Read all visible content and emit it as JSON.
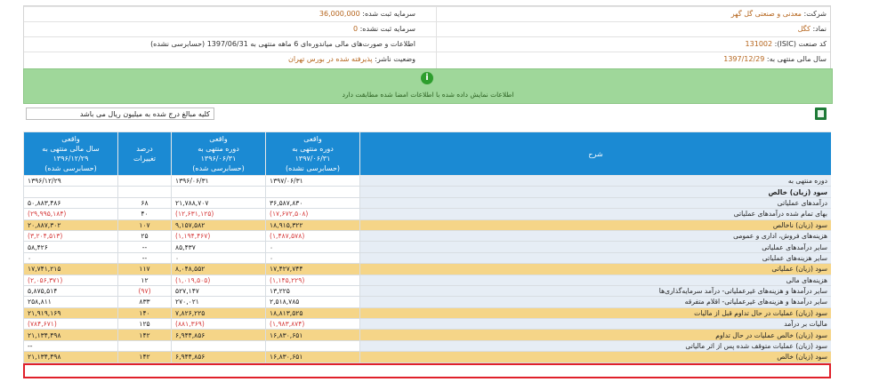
{
  "company_info": {
    "rows": [
      {
        "right_key": "شرکت:",
        "right_val": "معدنی و صنعتی گل گهر",
        "left_key": "سرمایه ثبت شده:",
        "left_val": "36,000,000"
      },
      {
        "right_key": "نماد:",
        "right_val": "کگل",
        "left_key": "سرمایه ثبت نشده:",
        "left_val": "0"
      },
      {
        "right_key": "کد صنعت (ISIC):",
        "right_val": "131002",
        "left_key": "اطلاعات و صورت‌های مالی میاندوره‌ای 6 ماهه منتهی به 1397/06/31 (حسابرسی نشده)",
        "left_val": ""
      },
      {
        "right_key": "سال مالی منتهی به:",
        "right_val": "1397/12/29",
        "left_key": "وضعیت ناشر:",
        "left_val": "پذیرفته شده در بورس تهران"
      }
    ]
  },
  "notice": {
    "icon": "i",
    "text": "اطلاعات نمایش داده شده با اطلاعات امضا شده مطابقت دارد"
  },
  "unit_note": "کلیه مبالغ درج شده به میلیون ریال می باشد",
  "table": {
    "headers": {
      "desc": "شرح",
      "c1": [
        "واقعی",
        "دوره منتهی به",
        "۱۳۹۷/۰۶/۳۱",
        "(حسابرسی نشده)"
      ],
      "c2": [
        "واقعی",
        "دوره منتهی به",
        "۱۳۹۶/۰۶/۳۱",
        "(حسابرسی شده)"
      ],
      "c3": [
        "درصد",
        "تغییرات"
      ],
      "c4": [
        "واقعی",
        "سال مالی منتهی به",
        "۱۳۹۶/۱۲/۲۹",
        "(حسابرسی شده)"
      ]
    },
    "rows": [
      {
        "desc": "دوره منتهی به",
        "c1": "۱۳۹۷/۰۶/۳۱",
        "c2": "۱۳۹۶/۰۶/۳۱",
        "c3": "",
        "c4": "۱۳۹۶/۱۲/۲۹",
        "hl": false
      },
      {
        "desc": "سود (زیان) خالص",
        "c1": "",
        "c2": "",
        "c3": "",
        "c4": "",
        "hl": false,
        "bold": true
      },
      {
        "desc": "درآمدهای عملیاتی",
        "c1": "۳۶,۵۸۷,۸۳۰",
        "c2": "۲۱,۷۸۸,۷۰۷",
        "c3": "۶۸",
        "c4": "۵۰,۸۸۳,۴۸۶",
        "hl": false
      },
      {
        "desc": "بهای تمام شده درآمدهای عملیاتی",
        "c1": "(۱۷,۶۷۲,۵۰۸)",
        "c2": "(۱۲,۶۳۱,۱۲۵)",
        "c3": "۴۰",
        "c4": "(۲۹,۹۹۵,۱۸۴)",
        "hl": false,
        "neg": true
      },
      {
        "desc": "سود (زیان) ناخالص",
        "c1": "۱۸,۹۱۵,۳۲۲",
        "c2": "۹,۱۵۷,۵۸۲",
        "c3": "۱۰۷",
        "c4": "۲۰,۸۸۷,۳۰۲",
        "hl": true
      },
      {
        "desc": "هزینه‌های فروش، اداری و عمومی",
        "c1": "(۱,۴۸۷,۵۷۸)",
        "c2": "(۱,۱۹۴,۴۶۷)",
        "c3": "۲۵",
        "c4": "(۳,۲۰۴,۵۱۳)",
        "hl": false,
        "neg": true
      },
      {
        "desc": "سایر درآمدهای عملیاتی",
        "c1": "۰",
        "c2": "۸۵,۴۳۷",
        "c3": "--",
        "c4": "۵۸,۴۲۶",
        "hl": false
      },
      {
        "desc": "سایر هزینه‌های عملیاتی",
        "c1": "۰",
        "c2": "۰",
        "c3": "--",
        "c4": "۰",
        "hl": false
      },
      {
        "desc": "سود (زیان) عملیاتی",
        "c1": "۱۷,۴۲۷,۷۴۴",
        "c2": "۸,۰۴۸,۵۵۲",
        "c3": "۱۱۷",
        "c4": "۱۷,۷۴۱,۲۱۵",
        "hl": true
      },
      {
        "desc": "هزینه‌های مالی",
        "c1": "(۱,۱۴۵,۲۲۹)",
        "c2": "(۱,۰۱۹,۵۰۵)",
        "c3": "۱۲",
        "c4": "(۲,۰۵۶,۳۷۱)",
        "hl": false,
        "neg": true
      },
      {
        "desc": "سایر درآمدها و هزینه‌های غیرعملیاتی- درآمد سرمایه‌گذاری‌ها",
        "c1": "۱۳,۲۲۵",
        "c2": "۵۲۷,۱۴۷",
        "c3": "(۹۷)",
        "c4": "۵,۸۷۵,۵۱۴",
        "hl": false,
        "neg3": true
      },
      {
        "desc": "سایر درآمدها و هزینه‌های غیرعملیاتی- اقلام متفرقه",
        "c1": "۲,۵۱۸,۷۸۵",
        "c2": "۲۷۰,۰۲۱",
        "c3": "۸۳۳",
        "c4": "۲۵۸,۸۱۱",
        "hl": false
      },
      {
        "desc": "سود (زیان) عملیات در حال تداوم قبل از مالیات",
        "c1": "۱۸,۸۱۳,۵۲۵",
        "c2": "۷,۸۲۶,۲۲۵",
        "c3": "۱۴۰",
        "c4": "۲۱,۹۱۹,۱۶۹",
        "hl": true
      },
      {
        "desc": "مالیات بر درآمد",
        "c1": "(۱,۹۸۳,۸۷۴)",
        "c2": "(۸۸۱,۳۶۹)",
        "c3": "۱۲۵",
        "c4": "(۷۸۴,۶۷۱)",
        "hl": false,
        "neg": true
      },
      {
        "desc": "سود (زیان) خالص عملیات در حال تداوم",
        "c1": "۱۶,۸۳۰,۶۵۱",
        "c2": "۶,۹۴۴,۸۵۶",
        "c3": "۱۴۲",
        "c4": "۲۱,۱۳۴,۴۹۸",
        "hl": true
      },
      {
        "desc": "سود (زیان) عملیات متوقف شده پس از اثر مالیاتی",
        "c1": "",
        "c2": "",
        "c3": "",
        "c4": "--",
        "hl": false
      },
      {
        "desc": "سود (زیان) خالص",
        "c1": "۱۶,۸۳۰,۶۵۱",
        "c2": "۶,۹۴۴,۸۵۶",
        "c3": "۱۴۲",
        "c4": "۲۱,۱۳۴,۴۹۸",
        "hl": true
      }
    ]
  }
}
